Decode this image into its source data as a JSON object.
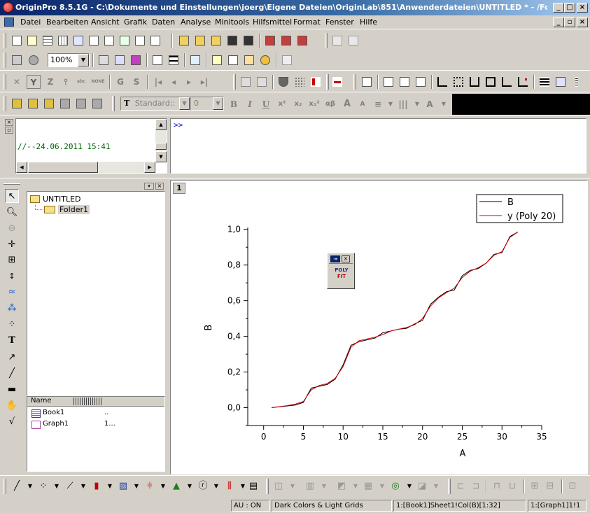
{
  "window": {
    "title": "OriginPro 8.5.1G - C:\\Dokumente und Einstellungen\\joerg\\Eigene Dateien\\OriginLab\\851\\Anwenderdateien\\UNTITLED * - /Folder1/ - ..."
  },
  "menu": {
    "items": [
      "Datei",
      "Bearbeiten",
      "Ansicht",
      "Grafik",
      "Daten",
      "Analyse",
      "Minitools",
      "Hilfsmittel",
      "Format",
      "Fenster",
      "Hilfe"
    ]
  },
  "toolbar": {
    "zoom_value": "100%",
    "font_value": "Standard::",
    "size_value": "0",
    "axis_buttons": [
      "X",
      "Y",
      "Z",
      "G",
      "S"
    ],
    "format_buttons": [
      "B",
      "I",
      "U",
      "x²",
      "x₂",
      "x₁²",
      "αβ",
      "A",
      "A"
    ]
  },
  "script_window": {
    "history_line": "//--24.06.2011 15:41",
    "command_prompt": ">>"
  },
  "project_explorer": {
    "root": "UNTITLED",
    "folder": "Folder1",
    "list_header": "Name",
    "items": [
      {
        "name": "Book1",
        "extra": ".."
      },
      {
        "name": "Graph1",
        "extra": "1..."
      }
    ]
  },
  "graph": {
    "layer_label": "1"
  },
  "poly_fit_panel": {
    "line1": "POLY",
    "line2": "FIT"
  },
  "chart_data": {
    "type": "line",
    "xlabel": "A",
    "ylabel": "B",
    "xlim": [
      -2,
      35
    ],
    "ylim": [
      -0.1,
      1.05
    ],
    "xticks": [
      "0",
      "5",
      "10",
      "15",
      "20",
      "25",
      "30",
      "35"
    ],
    "yticks": [
      "0,0",
      "0,2",
      "0,4",
      "0,6",
      "0,8",
      "1,0"
    ],
    "legend_position": "top-right",
    "series": [
      {
        "name": "B",
        "color": "#000000",
        "x": [
          1,
          2,
          3,
          4,
          5,
          6,
          7,
          8,
          9,
          10,
          11,
          12,
          13,
          14,
          15,
          16,
          17,
          18,
          19,
          20,
          21,
          22,
          23,
          24,
          25,
          26,
          27,
          28,
          29,
          30,
          31,
          32
        ],
        "y": [
          0.0,
          0.005,
          0.01,
          0.015,
          0.03,
          0.11,
          0.12,
          0.13,
          0.16,
          0.24,
          0.35,
          0.37,
          0.38,
          0.39,
          0.42,
          0.43,
          0.44,
          0.445,
          0.47,
          0.49,
          0.58,
          0.62,
          0.65,
          0.66,
          0.74,
          0.77,
          0.78,
          0.81,
          0.86,
          0.87,
          0.96,
          0.985
        ]
      },
      {
        "name": "y (Poly 20)",
        "color": "#cc0000",
        "x": [
          1,
          2,
          3,
          4,
          5,
          6,
          7,
          8,
          9,
          10,
          11,
          12,
          13,
          14,
          15,
          16,
          17,
          18,
          19,
          20,
          21,
          22,
          23,
          24,
          25,
          26,
          27,
          28,
          29,
          30,
          31,
          32
        ],
        "y": [
          0.0,
          0.006,
          0.012,
          0.02,
          0.035,
          0.1,
          0.125,
          0.135,
          0.165,
          0.23,
          0.34,
          0.375,
          0.385,
          0.395,
          0.41,
          0.43,
          0.44,
          0.45,
          0.465,
          0.5,
          0.57,
          0.615,
          0.645,
          0.67,
          0.73,
          0.765,
          0.785,
          0.81,
          0.855,
          0.875,
          0.955,
          0.985
        ]
      }
    ]
  },
  "status_bar": {
    "cells": [
      "AU : ON",
      "Dark Colors & Light Grids",
      "1:[Book1]Sheet1!Col(B)[1:32]",
      "1:[Graph1]1!1"
    ]
  },
  "colors": {
    "title_active": "#0a246a",
    "chrome": "#d4d0c8",
    "fit_line": "#cc0000"
  }
}
